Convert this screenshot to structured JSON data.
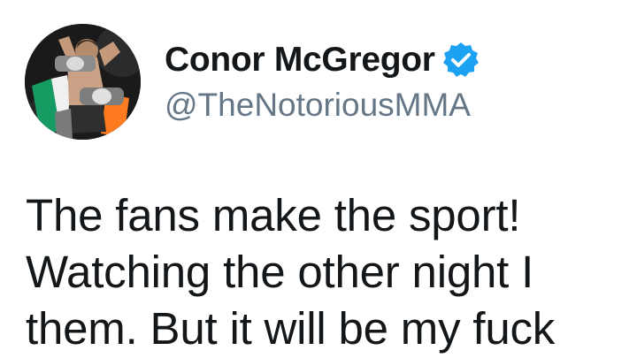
{
  "tweet": {
    "display_name": "Conor McGregor",
    "handle": "@TheNotoriousMMA",
    "verified": true,
    "text_lines": [
      "The fans make the sport!",
      "Watching the other night I",
      "them. But it will be my fuck"
    ]
  },
  "colors": {
    "verified_badge": "#1da1f2",
    "handle_text": "#657786",
    "body_text": "#14171a"
  },
  "icons": {
    "verified": "verified-check-icon",
    "avatar": "profile-photo"
  }
}
